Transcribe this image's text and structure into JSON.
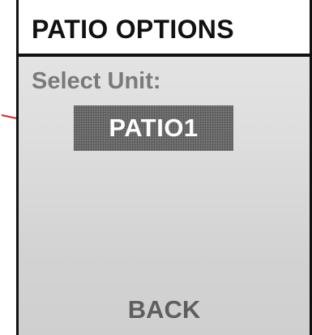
{
  "screen": {
    "title": "PATIO OPTIONS",
    "prompt": "Select Unit:",
    "selected_unit": "PATIO1",
    "back_label": "BACK"
  },
  "annotation": {
    "arrow_icon": "arrow-right-icon",
    "arrow_color": "#e0202a"
  },
  "colors": {
    "highlight": "#6a6a6a",
    "title_text": "#111111",
    "prompt_text": "#7a7a7a",
    "back_text": "#5e5e5e"
  }
}
